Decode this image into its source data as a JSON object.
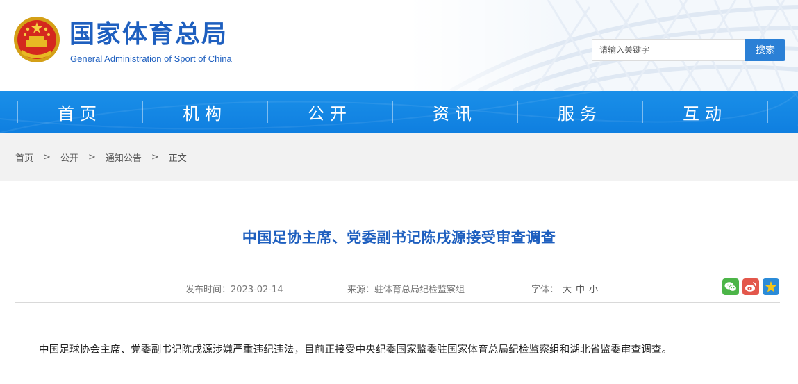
{
  "header": {
    "site_title": "国家体育总局",
    "site_subtitle": "General Administration of Sport of China",
    "search": {
      "placeholder": "请输入关键字",
      "button_label": "搜索"
    }
  },
  "nav": {
    "items": [
      {
        "label": "首页"
      },
      {
        "label": "机构"
      },
      {
        "label": "公开"
      },
      {
        "label": "资讯"
      },
      {
        "label": "服务"
      },
      {
        "label": "互动"
      }
    ]
  },
  "breadcrumb": {
    "items": [
      "首页",
      "公开",
      "通知公告",
      "正文"
    ],
    "separator": ">"
  },
  "article": {
    "title": "中国足协主席、党委副书记陈戌源接受审查调查",
    "date_label": "发布时间：2023-02-14",
    "source_label": "来源：驻体育总局纪检监察组",
    "font_label": "字体：",
    "font_options": [
      "大",
      "中",
      "小"
    ],
    "body": "中国足球协会主席、党委副书记陈戌源涉嫌严重违纪违法，目前正接受中央纪委国家监委驻国家体育总局纪检监察组和湖北省监委审查调查。"
  },
  "colors": {
    "brand_blue": "#1e5fbf",
    "nav_blue": "#0f7fe0",
    "search_button": "#2b80d6",
    "wechat_green": "#4cb548",
    "weibo_red": "#e3574b",
    "qzone_blue": "#2b8bd8"
  },
  "icons": [
    "national-emblem-icon",
    "wechat-icon",
    "weibo-icon",
    "qzone-icon"
  ]
}
